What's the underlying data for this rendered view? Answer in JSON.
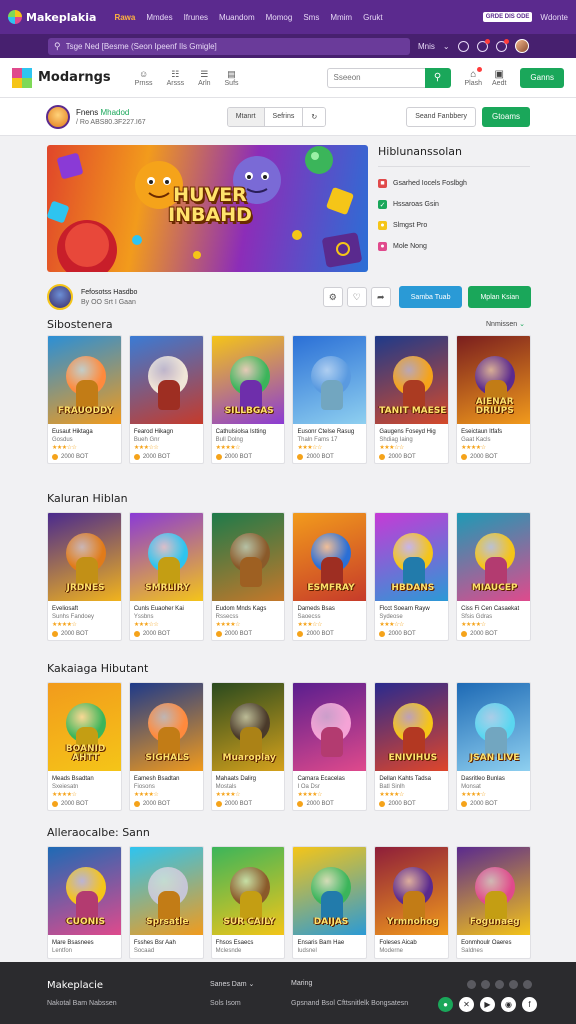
{
  "topbar": {
    "brand": "Makeplakia",
    "nav": [
      "Rawa",
      "Mmdes",
      "Ifrunes",
      "Muandom",
      "Momog",
      "Sms",
      "Mmim",
      "Grukt"
    ],
    "active_nav": "Rawa",
    "promo_badge": "GRDE DIS ODE",
    "right_link": "Wdonte"
  },
  "subbar": {
    "search_placeholder": "Tsge Ned [Besme (Seon Ipeenf Ils Gmigle]",
    "right_label": "Mnis"
  },
  "header": {
    "logo": "Modarngs",
    "nav": [
      {
        "icon": "person-icon",
        "glyph": "☺",
        "label": "Prnss"
      },
      {
        "icon": "chat-icon",
        "glyph": "☷",
        "label": "Arsss"
      },
      {
        "icon": "grid-icon",
        "glyph": "☰",
        "label": "Arln"
      },
      {
        "icon": "doc-icon",
        "glyph": "▤",
        "label": "Sufs"
      }
    ],
    "search_placeholder": "Sseeon",
    "icons": [
      {
        "icon": "store-icon",
        "glyph": "⌂",
        "label": "Plash"
      },
      {
        "icon": "bag-icon",
        "glyph": "▣",
        "label": "Aedt"
      }
    ],
    "cta": "Ganns"
  },
  "profile": {
    "name": "Fnens",
    "name_highlight": "Mhadod",
    "subtitle": "/ Ro ABS80.3F227.I67",
    "seg": [
      "Mtanrt",
      "Sefrins"
    ],
    "outline_btn": "Seand Fanbbery",
    "green_btn": "Gtoams"
  },
  "hero": {
    "title_line1": "HUVER",
    "title_line2": "INBAHD"
  },
  "side_panel": {
    "title": "Hiblunanssolan",
    "items": [
      {
        "label": "Gsarhed Iocels Foslbgh",
        "color": "#e04a4a",
        "glyph": "■"
      },
      {
        "label": "Hssaroas Gsin",
        "color": "#1aa75a",
        "glyph": "✓"
      },
      {
        "label": "Slmgst Pro",
        "color": "#f5c518",
        "glyph": "●"
      },
      {
        "label": "Mole Nong",
        "color": "#e04a8c",
        "glyph": "●"
      }
    ]
  },
  "creator": {
    "name": "Fefosotss Hasdbo",
    "subtitle": "By OO Srt I Gaan",
    "btn_primary": "Samba Tuab",
    "btn_green": "Mplan Ksian"
  },
  "sections": [
    {
      "title": "Sibostenera",
      "more": "Nnmissen",
      "cards": [
        {
          "art": "FRAUODDY",
          "title": "Eusaut Hiktaga",
          "sub": "Gosdus",
          "stars": "★★★☆☆",
          "count": "2000 BOT",
          "c1": "#2b8fd6",
          "c2": "#f29b1c",
          "c3": "#ff8a3d"
        },
        {
          "art": "",
          "title": "Fearod Hikagn",
          "sub": "Bueh Gnr",
          "stars": "★★★☆☆",
          "count": "2000 BOT",
          "c1": "#3a7bd5",
          "c2": "#c63a2a",
          "c3": "#f0e6d8"
        },
        {
          "art": "SILLBGAS",
          "title": "Cathulsiolsa Istting",
          "sub": "Bull Dolng",
          "stars": "★★★★☆",
          "count": "2000 BOT",
          "c1": "#f5c518",
          "c2": "#8a3ad6",
          "c3": "#3bb55a"
        },
        {
          "art": "",
          "title": "Eusonr Ctelse Rasug",
          "sub": "Thaln Fams 17",
          "stars": "★★★☆☆",
          "count": "2000 BOT",
          "c1": "#2a6fd6",
          "c2": "#8fd0f0",
          "c3": "#5a9ae0"
        },
        {
          "art": "TANIT MAESE",
          "title": "Gaugens Foseyd Hig",
          "sub": "Shdiag Iaing",
          "stars": "★★★☆☆",
          "count": "2000 BOT",
          "c1": "#1e3a8a",
          "c2": "#d64a2a",
          "c3": "#f5a31a"
        },
        {
          "art": "AIENAR DRIUPS",
          "title": "Eseictaun Itfafs",
          "sub": "Gaat Kacls",
          "stars": "★★★★☆",
          "count": "2000 BOT",
          "c1": "#7a1e1e",
          "c2": "#f29b1c",
          "c3": "#5a2a8e"
        }
      ]
    },
    {
      "title": "Kaluran Hiblan",
      "more": "",
      "cards": [
        {
          "art": "JRDNES",
          "title": "Eveliosaft",
          "sub": "Sunhs Fandoey",
          "stars": "★★★★☆",
          "count": "2000 BOT",
          "c1": "#4a2a8e",
          "c2": "#f2b41c",
          "c3": "#e07b1a"
        },
        {
          "art": "SMRLIRY",
          "title": "Cunls Euaoher Kai",
          "sub": "Yssbns",
          "stars": "★★★☆☆",
          "count": "2000 BOT",
          "c1": "#8a3ad6",
          "c2": "#f5c518",
          "c3": "#2ec4f0"
        },
        {
          "art": "",
          "title": "Eudom Mnds Kags",
          "sub": "Rssecss",
          "stars": "★★★★☆",
          "count": "2000 BOT",
          "c1": "#1e7a4a",
          "c2": "#c6782a",
          "c3": "#8a5a2a"
        },
        {
          "art": "ESMFRAY",
          "title": "Dameds Bsas",
          "sub": "Saoecss",
          "stars": "★★★☆☆",
          "count": "2000 BOT",
          "c1": "#f29b1c",
          "c2": "#c63a2a",
          "c3": "#2a6fd6"
        },
        {
          "art": "HBDANS",
          "title": "Flcct Soearn Rayw",
          "sub": "Sydeose",
          "stars": "★★★☆☆",
          "count": "2000 BOT",
          "c1": "#c63ad6",
          "c2": "#2a9ad6",
          "c3": "#f5c518"
        },
        {
          "art": "MIAUCEP",
          "title": "Ciss Fi Cen Casaekat",
          "sub": "Sfsis Gdras",
          "stars": "★★★★☆",
          "count": "2000 BOT",
          "c1": "#1e9ab5",
          "c2": "#e04a8c",
          "c3": "#f5c518"
        }
      ]
    },
    {
      "title": "Kakaiaga Hibutant",
      "more": "",
      "cards": [
        {
          "art": "BOANID AHTT",
          "title": "Meads Bsadtan",
          "sub": "Sxeiesatn",
          "stars": "★★★★☆",
          "count": "2000 BOT",
          "c1": "#f29b1c",
          "c2": "#f5c518",
          "c3": "#3bb55a"
        },
        {
          "art": "SIGHALS",
          "title": "Eamesh Bsadtan",
          "sub": "Fiosons",
          "stars": "★★★★☆",
          "count": "2000 BOT",
          "c1": "#1e3a8a",
          "c2": "#f29b1c",
          "c3": "#ff8a3d"
        },
        {
          "art": "Muaroplay",
          "title": "Mahaats Dalirg",
          "sub": "Mostals",
          "stars": "★★★★☆",
          "count": "2000 BOT",
          "c1": "#2a4a1e",
          "c2": "#d6a21c",
          "c3": "#4a3a2a"
        },
        {
          "art": "",
          "title": "Camara Ecacelas",
          "sub": "I Oa Dsr",
          "stars": "★★★★☆",
          "count": "2000 BOT",
          "c1": "#5a1e8e",
          "c2": "#e04a8c",
          "c3": "#f5a3d6"
        },
        {
          "art": "ENIVIHUS",
          "title": "Dellan Kahts Tadsa",
          "sub": "Batl Sinlh",
          "stars": "★★★★☆",
          "count": "2000 BOT",
          "c1": "#2a2a8e",
          "c2": "#e0462a",
          "c3": "#f5c518"
        },
        {
          "art": "JSAN LIVE",
          "title": "Dasritleo Bunlas",
          "sub": "Monsat",
          "stars": "★★★★☆",
          "count": "2000 BOT",
          "c1": "#1e6ab5",
          "c2": "#8fd0f0",
          "c3": "#5ad6f0"
        }
      ]
    },
    {
      "title": "Alleraocalbe: Sann",
      "more": "",
      "cards": [
        {
          "art": "CUONIS",
          "title": "Mare Bsasnees",
          "sub": "Lentfon",
          "stars": "",
          "count": "",
          "c1": "#1e6ab5",
          "c2": "#e04a8c",
          "c3": "#f5c518"
        },
        {
          "art": "Sprsatle",
          "title": "Fsshes Bsr Aah",
          "sub": "Socaad",
          "stars": "",
          "count": "",
          "c1": "#2ec4f0",
          "c2": "#f29b1c",
          "c3": "#c6c6d6"
        },
        {
          "art": "SUR CAILY",
          "title": "Fhsos Esaecs",
          "sub": "Mclesnde",
          "stars": "",
          "count": "",
          "c1": "#3bb55a",
          "c2": "#f5c518",
          "c3": "#8a5a2a"
        },
        {
          "art": "DAIJAS",
          "title": "Ensaris Bam Hae",
          "sub": "Iudsnel",
          "stars": "",
          "count": "",
          "c1": "#f5c518",
          "c2": "#2a9ad6",
          "c3": "#3bb55a"
        },
        {
          "art": "Yrmnohog",
          "title": "Foleses Aicab",
          "sub": "Moderne",
          "stars": "",
          "count": "",
          "c1": "#8e1e3a",
          "c2": "#f29b1c",
          "c3": "#5a2a8e"
        },
        {
          "art": "Fogunaeg",
          "title": "Eonmhoulr Oaeres",
          "sub": "Saldnes",
          "stars": "",
          "count": "",
          "c1": "#5a2a8e",
          "c2": "#f5c518",
          "c3": "#e04a8c"
        }
      ]
    }
  ],
  "footer": {
    "brand": "Makeplacie",
    "sub": "Nakotal Bam Nabssen",
    "col1_title": "Sanes Dam",
    "col1_sub": "Sols Isom",
    "col2_title": "Maring",
    "col2_sub": "Gpsnand Bsol Cfttsnitlelk Bongsatesn"
  },
  "colors": {
    "purple": "#5b2a8e",
    "green": "#1aa75a",
    "teal": "#2a9ad6"
  }
}
